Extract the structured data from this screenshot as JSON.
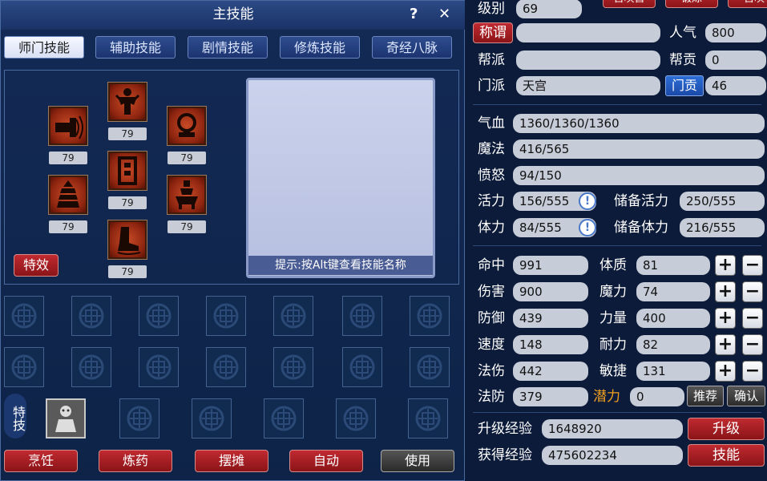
{
  "skill_window": {
    "title": "主技能",
    "help_icon": "?",
    "close_icon": "✕",
    "tabs": [
      "师门技能",
      "辅助技能",
      "剧情技能",
      "修炼技能",
      "奇经八脉"
    ],
    "skills": [
      {
        "icon": "cannon-icon",
        "level": "79"
      },
      {
        "icon": "warrior-statue-icon",
        "level": "79"
      },
      {
        "icon": "bell-icon",
        "level": "79"
      },
      {
        "icon": "pagoda-icon",
        "level": "79"
      },
      {
        "icon": "scroll-icon",
        "level": "79"
      },
      {
        "icon": "censer-icon",
        "level": "79"
      },
      {
        "icon": "boot-icon",
        "level": "79"
      }
    ],
    "effects_button": "特效",
    "hint": "提示:按Alt键查看技能名称",
    "special_label": "特技",
    "buttons": [
      "烹饪",
      "炼药",
      "摆摊",
      "自动",
      "使用"
    ]
  },
  "attributes": {
    "top_buttons": [
      "召唤兽",
      "锻炼",
      "召唤"
    ],
    "level": {
      "label": "级别",
      "value": "69"
    },
    "title": {
      "label": "称谓",
      "value": ""
    },
    "popularity": {
      "label": "人气",
      "value": "800"
    },
    "gang": {
      "label": "帮派",
      "value": ""
    },
    "gang_contribution": {
      "label": "帮贡",
      "value": "0"
    },
    "school": {
      "label": "门派",
      "value": "天宫"
    },
    "school_contribution": {
      "label": "门贡",
      "value": "46"
    },
    "hp": {
      "label": "气血",
      "value": "1360/1360/1360"
    },
    "mp": {
      "label": "魔法",
      "value": "416/565"
    },
    "rage": {
      "label": "愤怒",
      "value": "94/150"
    },
    "vitality": {
      "label": "活力",
      "value": "156/555"
    },
    "reserve_vitality": {
      "label": "储备活力",
      "value": "250/555"
    },
    "stamina": {
      "label": "体力",
      "value": "84/555"
    },
    "reserve_stamina": {
      "label": "储备体力",
      "value": "216/555"
    },
    "hit": {
      "label": "命中",
      "value": "991"
    },
    "constitution": {
      "label": "体质",
      "value": "81"
    },
    "damage": {
      "label": "伤害",
      "value": "900"
    },
    "magic_power": {
      "label": "魔力",
      "value": "74"
    },
    "defense": {
      "label": "防御",
      "value": "439"
    },
    "strength": {
      "label": "力量",
      "value": "400"
    },
    "speed": {
      "label": "速度",
      "value": "148"
    },
    "endurance": {
      "label": "耐力",
      "value": "82"
    },
    "spell_damage": {
      "label": "法伤",
      "value": "442"
    },
    "agility": {
      "label": "敏捷",
      "value": "131"
    },
    "spell_defense": {
      "label": "法防",
      "value": "379"
    },
    "potential": {
      "label": "潜力",
      "value": "0"
    },
    "recommend_button": "推荐",
    "confirm_button": "确认",
    "plus": "+",
    "minus": "−",
    "upgrade_exp": {
      "label": "升级经验",
      "value": "1648920"
    },
    "gained_exp": {
      "label": "获得经验",
      "value": "475602234"
    },
    "upgrade_button": "升级",
    "skill_button": "技能"
  },
  "colors": {
    "potential_label": "#f0a020",
    "accent_red": "#b0222a",
    "accent_blue": "#2a62c8"
  }
}
